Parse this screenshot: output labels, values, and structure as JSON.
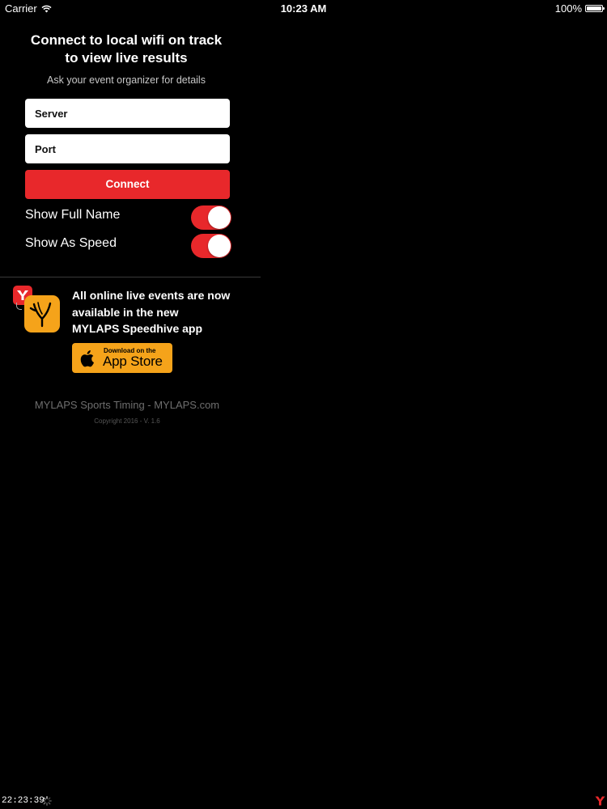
{
  "status_bar": {
    "carrier": "Carrier",
    "time": "10:23 AM",
    "battery": "100%",
    "icons": [
      "wifi-icon",
      "battery-icon"
    ]
  },
  "connect_panel": {
    "heading_line1": "Connect to local wifi on track",
    "heading_line2": "to view live results",
    "subtitle": "Ask your event organizer for details",
    "server_field": {
      "placeholder": "Server",
      "value": ""
    },
    "port_field": {
      "placeholder": "Port",
      "value": ""
    },
    "connect_label": "Connect",
    "toggles": [
      {
        "label": "Show Full Name",
        "on": true
      },
      {
        "label": "Show As Speed",
        "on": true
      }
    ]
  },
  "promo": {
    "line1": "All online live events are now",
    "line2": "available in the new",
    "line3": "MYLAPS Speedhive app",
    "badge_small": "Download on the",
    "badge_large": "App Store",
    "icons": [
      "mylaps-small-app-icon",
      "speedhive-app-icon",
      "apple-icon"
    ]
  },
  "footer": {
    "main": "MYLAPS Sports Timing - MYLAPS.com",
    "copyright": "Copyright 2016 - V. 1.6"
  },
  "bottom_bar": {
    "clock": "22:23:39",
    "icons": [
      "loading-spinner-icon",
      "mylaps-logo-icon"
    ]
  },
  "colors": {
    "background": "#000000",
    "accent_red": "#e8282b",
    "app_store_orange": "#f5a31a",
    "field_background": "#ffffff",
    "muted_text": "#6e6e6e"
  }
}
